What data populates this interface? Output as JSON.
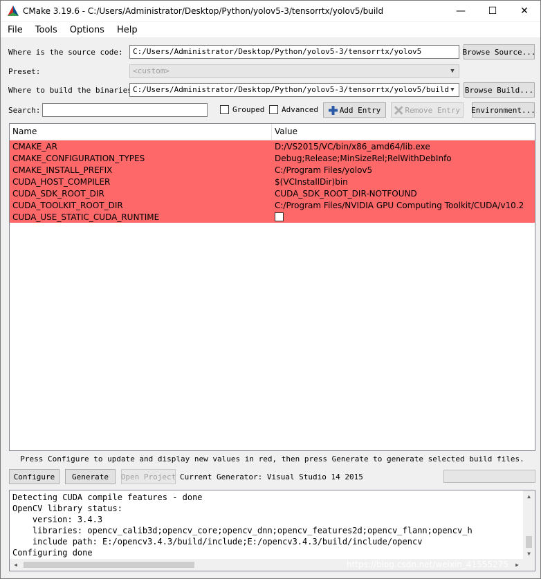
{
  "window": {
    "title": "CMake 3.19.6 - C:/Users/Administrator/Desktop/Python/yolov5-3/tensorrtx/yolov5/build",
    "minimize": "—",
    "maximize": "☐",
    "close": "✕"
  },
  "menu": {
    "file": "File",
    "tools": "Tools",
    "options": "Options",
    "help": "Help"
  },
  "form": {
    "source_label": "Where is the source code:",
    "source_value": "C:/Users/Administrator/Desktop/Python/yolov5-3/tensorrtx/yolov5",
    "browse_source": "Browse Source...",
    "preset_label": "Preset:",
    "preset_value": "<custom>",
    "build_label": "Where to build the binaries:",
    "build_value": "C:/Users/Administrator/Desktop/Python/yolov5-3/tensorrtx/yolov5/build",
    "browse_build": "Browse Build...",
    "search_label": "Search:",
    "search_value": "",
    "grouped": "Grouped",
    "advanced": "Advanced",
    "add_entry": "Add Entry",
    "remove_entry": "Remove Entry",
    "environment": "Environment..."
  },
  "table": {
    "col_name": "Name",
    "col_value": "Value",
    "row_color": "#ff6868",
    "rows": [
      {
        "name": "CMAKE_AR",
        "value": "D:/VS2015/VC/bin/x86_amd64/lib.exe"
      },
      {
        "name": "CMAKE_CONFIGURATION_TYPES",
        "value": "Debug;Release;MinSizeRel;RelWithDebInfo"
      },
      {
        "name": "CMAKE_INSTALL_PREFIX",
        "value": "C:/Program Files/yolov5"
      },
      {
        "name": "CUDA_HOST_COMPILER",
        "value": "$(VCInstallDir)bin"
      },
      {
        "name": "CUDA_SDK_ROOT_DIR",
        "value": "CUDA_SDK_ROOT_DIR-NOTFOUND"
      },
      {
        "name": "CUDA_TOOLKIT_ROOT_DIR",
        "value": "C:/Program Files/NVIDIA GPU Computing Toolkit/CUDA/v10.2"
      },
      {
        "name": "CUDA_USE_STATIC_CUDA_RUNTIME",
        "value": "",
        "checkbox": true,
        "checked": false
      }
    ]
  },
  "hint": "Press Configure to update and display new values in red, then press Generate to generate selected build files.",
  "actions": {
    "configure": "Configure",
    "generate": "Generate",
    "open_project": "Open Project",
    "generator": "Current Generator: Visual Studio 14 2015"
  },
  "output": {
    "lines": [
      "Detecting CUDA compile features - done",
      "OpenCV library status:",
      "    version: 3.4.3",
      "    libraries: opencv_calib3d;opencv_core;opencv_dnn;opencv_features2d;opencv_flann;opencv_h",
      "    include path: E:/opencv3.4.3/build/include;E:/opencv3.4.3/build/include/opencv",
      "Configuring done"
    ]
  },
  "watermark": "https://blog.csdn.net/weixin_41555275"
}
